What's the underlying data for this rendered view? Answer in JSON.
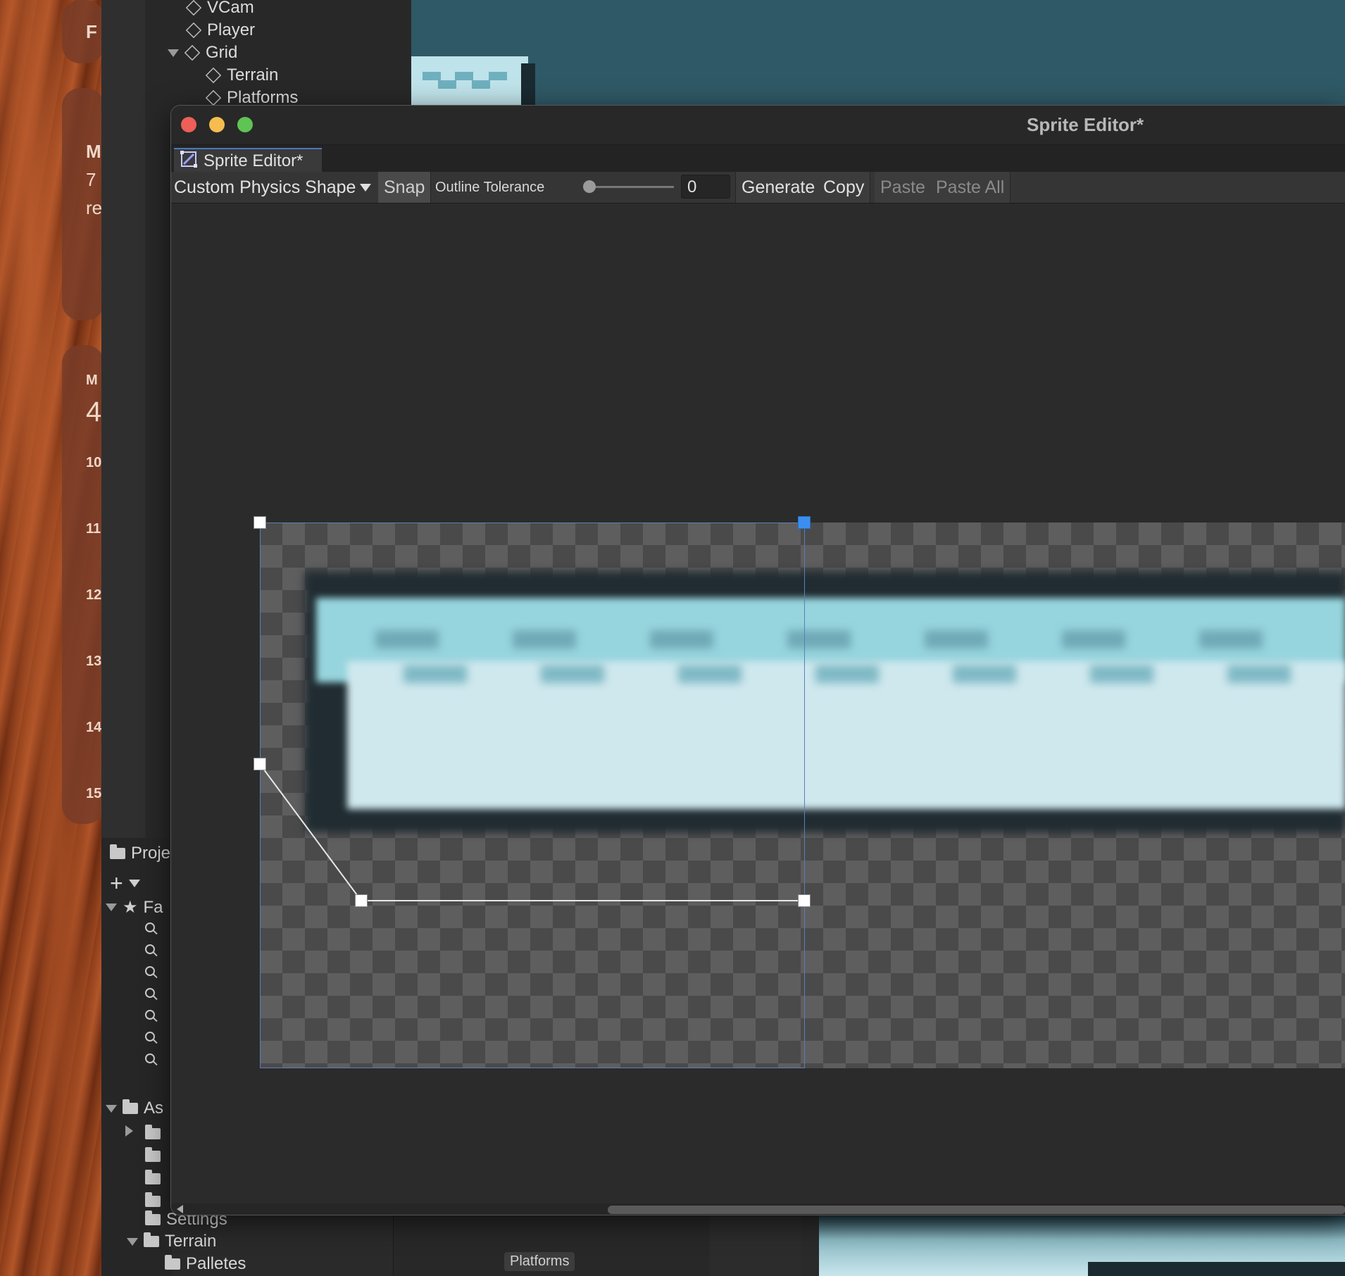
{
  "desktop": {
    "widgets": [
      "F",
      "M",
      "7",
      "re",
      "M",
      "4",
      "10",
      "11",
      "12",
      "13",
      "14",
      "15"
    ]
  },
  "hierarchy": {
    "items": [
      "VCam",
      "Player",
      "Grid",
      "Terrain",
      "Platforms"
    ]
  },
  "project": {
    "tab_label": "Proje",
    "favorites_label": "Fa",
    "assets_label": "As",
    "folders": [
      "Settings",
      "Terrain",
      "Palletes"
    ]
  },
  "scene_bottom": {
    "badge": "Platforms"
  },
  "window": {
    "title": "Sprite Editor*",
    "tab_label": "Sprite Editor*",
    "toolbar": {
      "mode_dropdown": "Custom Physics Shape",
      "snap": "Snap",
      "outline_tolerance_label": "Outline Tolerance",
      "outline_tolerance_value": "0",
      "outline_tolerance_slider": 0,
      "generate": "Generate",
      "copy": "Copy",
      "paste": "Paste",
      "paste_all": "Paste All"
    }
  },
  "colors": {
    "accent": "#3b8ef0",
    "close": "#ed5f57",
    "minimize": "#f5bd4f",
    "maximize": "#5fc454"
  }
}
